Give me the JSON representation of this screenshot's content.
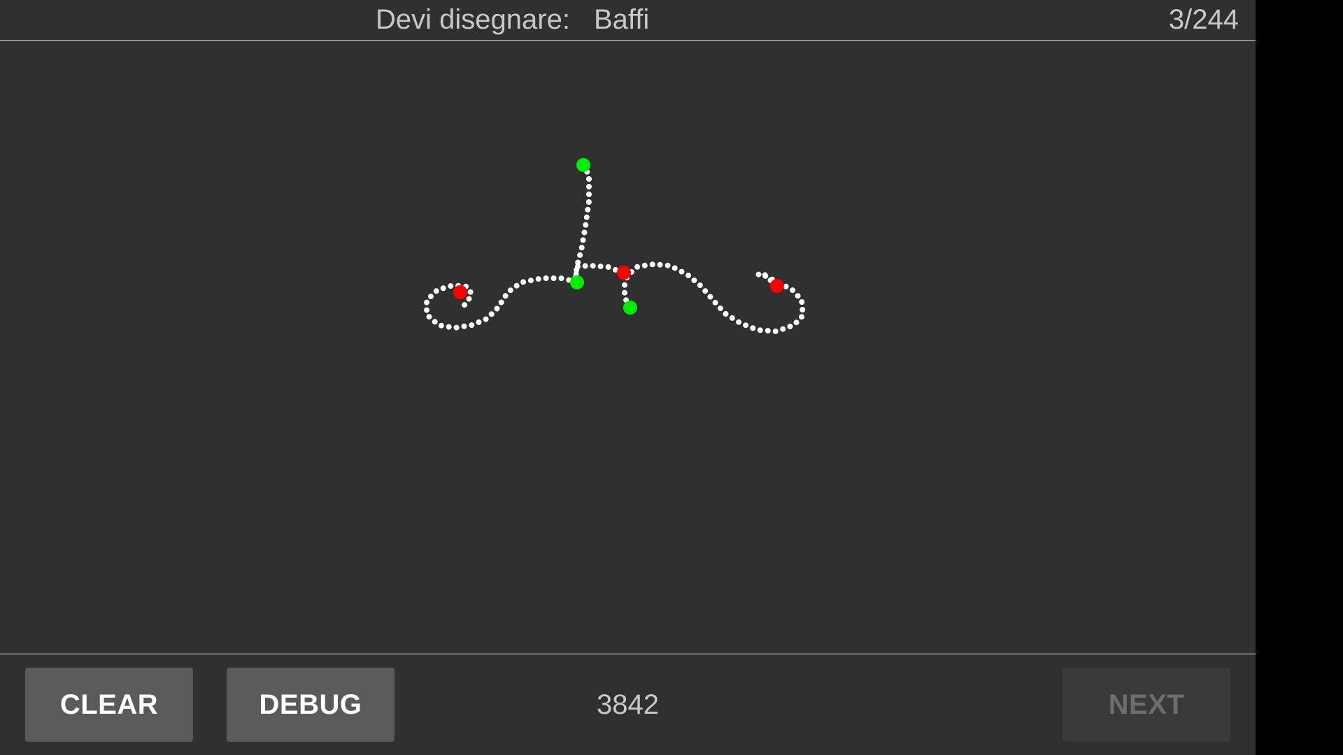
{
  "header": {
    "prompt_label": "Devi disegnare:",
    "target_word": "Baffi",
    "progress": "3/244"
  },
  "drawing": {
    "point_color": "#ffffff",
    "stroke_start_color": "#00ee00",
    "stroke_end_color": "#ff0000"
  },
  "footer": {
    "clear_label": "CLEAR",
    "debug_label": "DEBUG",
    "score": "3842",
    "next_label": "NEXT"
  },
  "colors": {
    "background": "#303030",
    "button": "#5a5a5c",
    "button_disabled": "#3a3a3a",
    "text": "#c8c8c8"
  }
}
